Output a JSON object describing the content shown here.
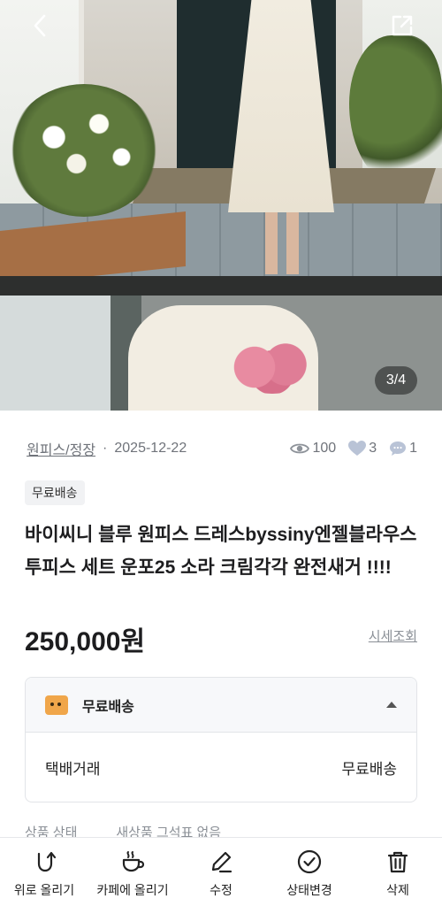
{
  "photo": {
    "counter": "3/4",
    "back_icon": "chevron-left-icon",
    "share_icon": "external-link-icon"
  },
  "meta": {
    "category": "원피스/정장",
    "date": "2025-12-22",
    "views": "100",
    "likes": "3",
    "chats": "1"
  },
  "badge": "무료배송",
  "title": "바이씨니 블루 원피스 드레스byssiny엔젤블라우스 투피스 세트 운포25 소라 크림각각 완전새거 !!!!",
  "price": "250,000원",
  "price_link": "시세조회",
  "shipping": {
    "header": "무료배송",
    "row_label": "택배거래",
    "row_value": "무료배송"
  },
  "condition": {
    "label": "상품 상태",
    "value": "새상품 그석표 없음"
  },
  "bottom_bar": [
    {
      "label": "위로 올리기",
      "icon": "bump-up-icon"
    },
    {
      "label": "카페에 올리기",
      "icon": "cafe-cup-icon"
    },
    {
      "label": "수정",
      "icon": "pencil-icon"
    },
    {
      "label": "상태변경",
      "icon": "check-circle-icon"
    },
    {
      "label": "삭제",
      "icon": "trash-icon"
    }
  ],
  "colors": {
    "text": "#1d1d1f",
    "muted": "#6f737a",
    "border": "#e2e4e8"
  }
}
